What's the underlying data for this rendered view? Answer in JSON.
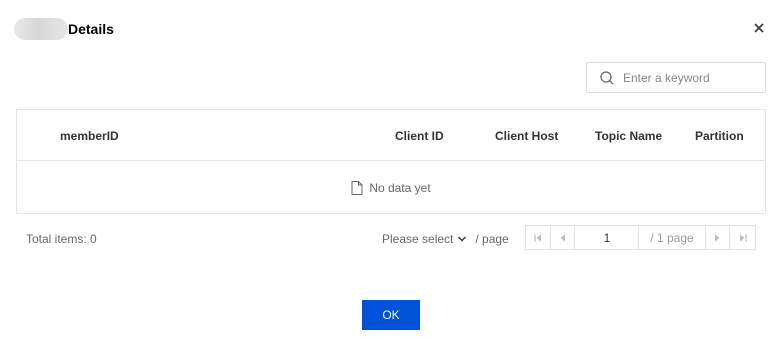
{
  "dialog": {
    "title": "Details",
    "close_icon": "close-icon"
  },
  "search": {
    "placeholder": "Enter a keyword",
    "value": "",
    "icon": "search-icon"
  },
  "table": {
    "columns": [
      "memberID",
      "Client ID",
      "Client Host",
      "Topic Name",
      "Partition"
    ],
    "rows": [],
    "empty_text": "No data yet",
    "empty_icon": "file-icon"
  },
  "footer": {
    "total": "Total items: 0"
  },
  "pagination": {
    "page_size_label": "Please select",
    "per_page": "/ page",
    "current_page": "1",
    "total_pages": "/ 1 page"
  },
  "actions": {
    "ok_label": "OK"
  },
  "colors": {
    "primary": "#0052d9",
    "border": "#e5e5e5"
  }
}
